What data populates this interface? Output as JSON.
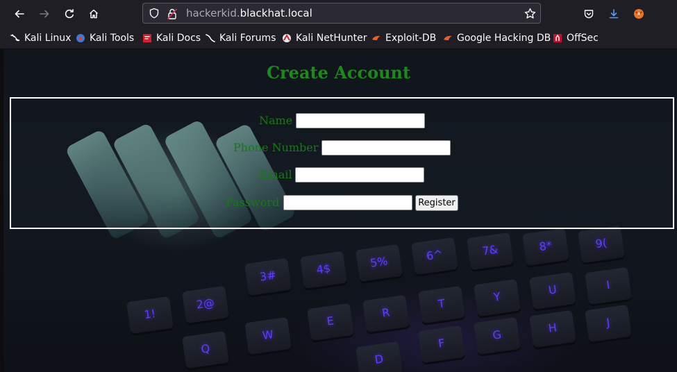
{
  "browser": {
    "url_subdomain": "hackerkid.",
    "url_domain": "blackhat.local",
    "bookmarks": [
      {
        "label": "Kali Linux",
        "icon": "kali-dragon-icon"
      },
      {
        "label": "Kali Tools",
        "icon": "kali-tools-icon"
      },
      {
        "label": "Kali Docs",
        "icon": "kali-docs-icon"
      },
      {
        "label": "Kali Forums",
        "icon": "kali-forums-icon"
      },
      {
        "label": "Kali NetHunter",
        "icon": "nethunter-icon"
      },
      {
        "label": "Exploit-DB",
        "icon": "exploit-db-icon"
      },
      {
        "label": "Google Hacking DB",
        "icon": "ghdb-icon"
      },
      {
        "label": "OffSec",
        "icon": "offsec-icon"
      }
    ]
  },
  "page": {
    "title": "Create Account",
    "form": {
      "name_label": "Name",
      "phone_label": "Phone Number",
      "email_label": "Email",
      "password_label": "Password",
      "name_value": "",
      "phone_value": "",
      "email_value": "",
      "password_value": "",
      "register_label": "Register"
    }
  },
  "colors": {
    "heading": "#1b8a1b",
    "label": "#157a15",
    "form_border": "#ffffff",
    "chrome": "#1f1e25",
    "key_legend": "#5d3cff"
  }
}
